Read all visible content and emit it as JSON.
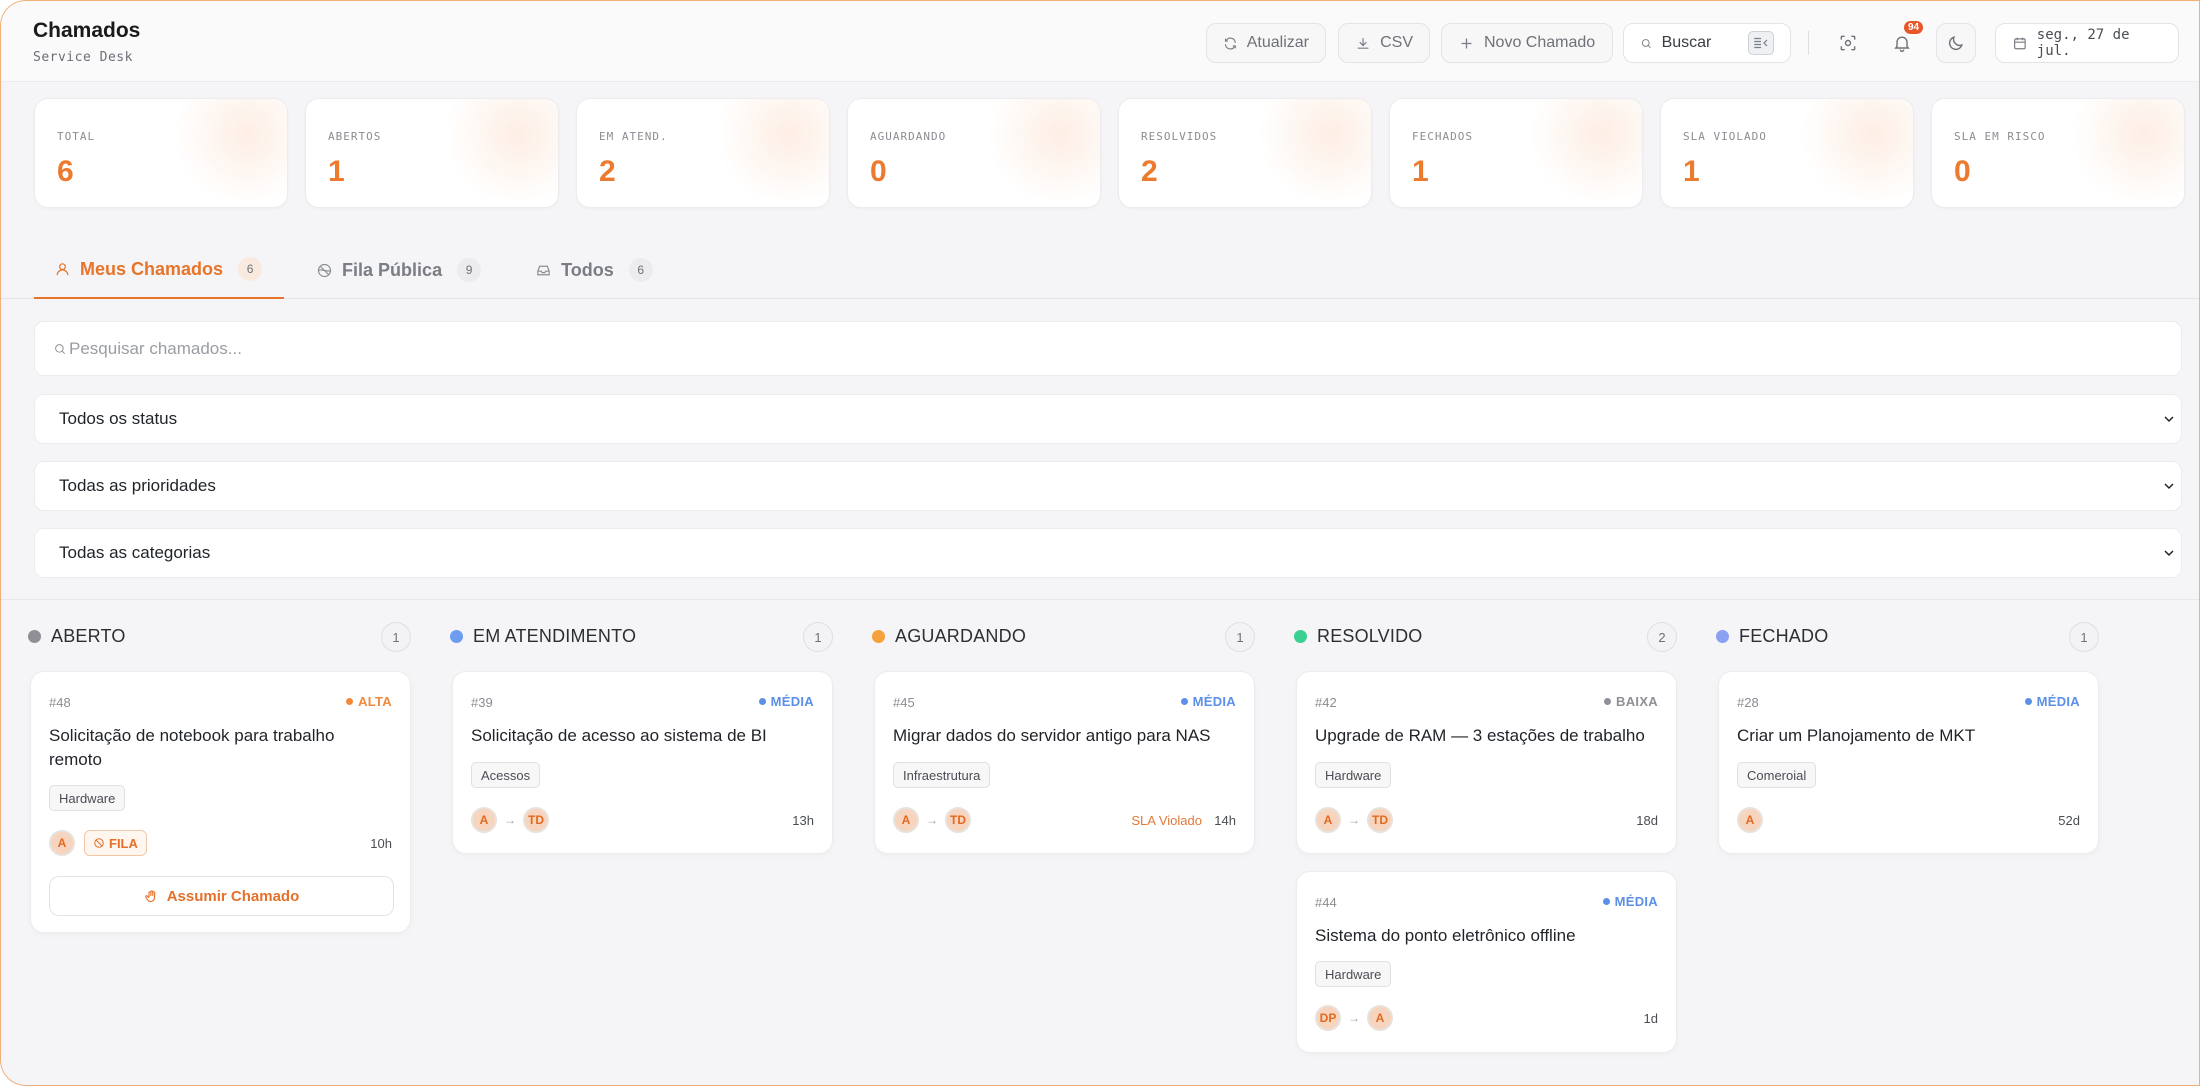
{
  "header": {
    "title": "Chamados",
    "subtitle": "Service Desk",
    "refresh_label": "Atualizar",
    "csv_label": "CSV",
    "new_ticket_label": "Novo Chamado",
    "search_label": "Buscar",
    "notification_count": "94",
    "date": "seg., 27 de jul."
  },
  "stats": [
    {
      "label": "TOTAL",
      "value": "6"
    },
    {
      "label": "ABERTOS",
      "value": "1"
    },
    {
      "label": "EM ATEND.",
      "value": "2"
    },
    {
      "label": "AGUARDANDO",
      "value": "0"
    },
    {
      "label": "RESOLVIDOS",
      "value": "2"
    },
    {
      "label": "FECHADOS",
      "value": "1"
    },
    {
      "label": "SLA VIOLADO",
      "value": "1"
    },
    {
      "label": "SLA EM RISCO",
      "value": "0"
    }
  ],
  "tabs": [
    {
      "label": "Meus Chamados",
      "count": "6",
      "icon": "user-icon",
      "active": true
    },
    {
      "label": "Fila Pública",
      "count": "9",
      "icon": "globe-icon",
      "active": false
    },
    {
      "label": "Todos",
      "count": "6",
      "icon": "inbox-icon",
      "active": false
    }
  ],
  "filters": {
    "search_placeholder": "Pesquisar chamados...",
    "status": "Todos os status",
    "priority": "Todas as prioridades",
    "category": "Todas as categorias"
  },
  "colors": {
    "accent": "#ec7a2f",
    "status_aberto": "#8e9096",
    "status_em_atendimento": "#6d9cf0",
    "status_aguardando": "#f5a23c",
    "status_resolvido": "#3ccf93",
    "status_fechado": "#8aa0f2",
    "prio_alta": "#f08a3a",
    "prio_media": "#5b8fe8",
    "prio_baixa": "#8e9096"
  },
  "columns": [
    {
      "title": "ABERTO",
      "count": "1",
      "cards": [
        {
          "id": "#48",
          "priority": "ALTA",
          "title": "Solicitação de notebook para trabalho remoto",
          "tag": "Hardware",
          "avatars": [
            "A"
          ],
          "fila": "FILA",
          "age": "10h",
          "action": "Assumir Chamado"
        }
      ]
    },
    {
      "title": "EM ATENDIMENTO",
      "count": "1",
      "cards": [
        {
          "id": "#39",
          "priority": "MÉDIA",
          "title": "Solicitação de acesso ao sistema de BI",
          "tag": "Acessos",
          "avatars": [
            "A",
            "TD"
          ],
          "age": "13h"
        }
      ]
    },
    {
      "title": "AGUARDANDO",
      "count": "1",
      "cards": [
        {
          "id": "#45",
          "priority": "MÉDIA",
          "title": "Migrar dados do servidor antigo para NAS",
          "tag": "Infraestrutura",
          "avatars": [
            "A",
            "TD"
          ],
          "sla": "SLA Violado",
          "age": "14h"
        }
      ]
    },
    {
      "title": "RESOLVIDO",
      "count": "2",
      "cards": [
        {
          "id": "#42",
          "priority": "BAIXA",
          "title": "Upgrade de RAM — 3 estações de trabalho",
          "tag": "Hardware",
          "avatars": [
            "A",
            "TD"
          ],
          "age": "18d"
        },
        {
          "id": "#44",
          "priority": "MÉDIA",
          "title": "Sistema do ponto eletrônico offline",
          "tag": "Hardware",
          "avatars": [
            "DP",
            "A"
          ],
          "age": "1d"
        }
      ]
    },
    {
      "title": "FECHADO",
      "count": "1",
      "cards": [
        {
          "id": "#28",
          "priority": "MÉDIA",
          "title": "Criar um Planojamento de MKT",
          "tag": "Comeroial",
          "avatars": [
            "A"
          ],
          "age": "52d"
        }
      ]
    }
  ]
}
